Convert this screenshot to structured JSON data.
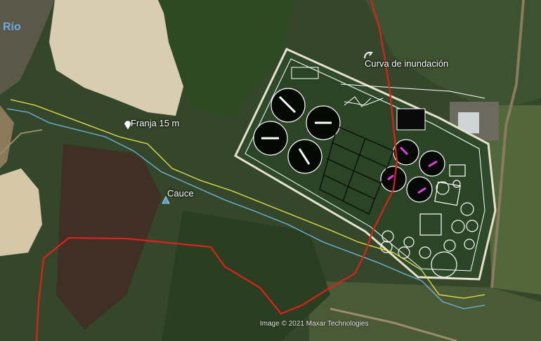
{
  "labels": {
    "river": "Río",
    "flood_curve": "Curva de inundación",
    "strip": "Franja 15 m",
    "channel": "Cauce"
  },
  "attribution": "Image © 2021 Maxar Technologies",
  "colors": {
    "flood_curve_line": "#e0201c",
    "strip_line": "#e8e34a",
    "channel_line": "#6fb7e0",
    "plant_outline": "#ffffff",
    "river_label": "#6fa8dc",
    "marker_magenta": "#e040e0"
  },
  "icons": [
    "pin-icon",
    "location-pin-icon",
    "triangle-marker-icon"
  ]
}
